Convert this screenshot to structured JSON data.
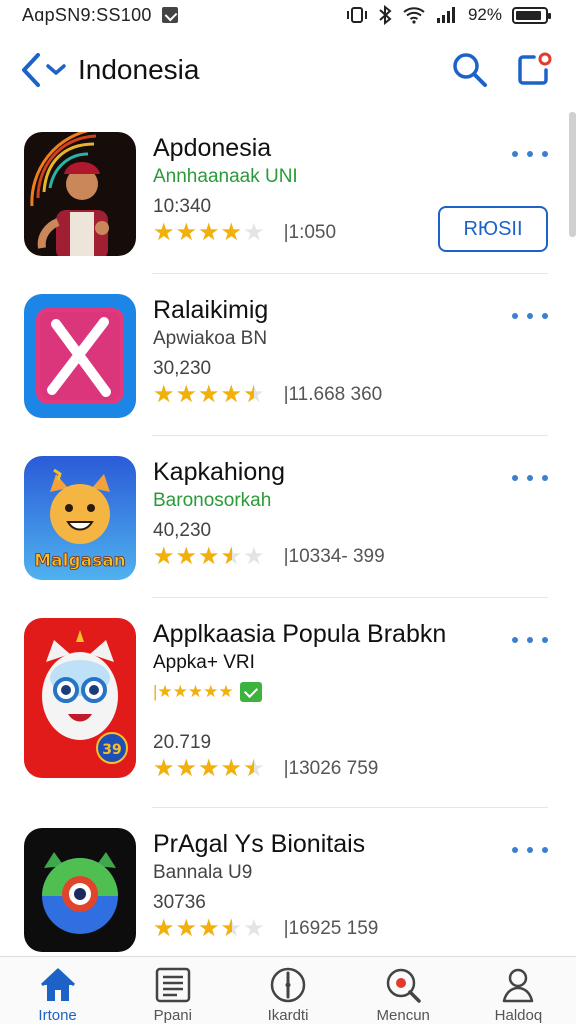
{
  "status_bar": {
    "time_text": "AɑpSN9:SS100",
    "battery": "92%",
    "battery_level": 0.92,
    "signal": "ıll"
  },
  "nav": {
    "title": "Indonesia"
  },
  "colors": {
    "accent": "#1d63c7",
    "star": "#f2b00a",
    "green_subtitle": "#2a9a3a"
  },
  "apps": [
    {
      "name": "Apdonesia",
      "subtitle": "Annhaanaak UNI",
      "subtitle_color": "#2a9a3a",
      "count": "10:340",
      "stars": 4,
      "rating_count": "|1:050",
      "button": "RЮSII"
    },
    {
      "name": "Ralaikimig",
      "subtitle": "Apwiakoa BN",
      "subtitle_color": "#444444",
      "count": "30,230",
      "stars": 4.5,
      "rating_count": "|11.668  360"
    },
    {
      "name": "Kapkahiong",
      "subtitle": "Baronosorkah",
      "subtitle_color": "#2a9a3a",
      "count": "40,230",
      "stars": 3.5,
      "rating_count": "|10334-  399",
      "icon_text": "Malgasan"
    },
    {
      "name": "Applkaasia Popula Brabkn",
      "subtitle": "Appka+ VRI",
      "subtitle_color": "#111111",
      "mini_rating": "|★★★★★",
      "count": "20.719",
      "stars": 4.5,
      "rating_count": "|13026  759",
      "icon_badge": "39"
    },
    {
      "name": "PrAgal Ys Bionitais",
      "subtitle": "Bannala U9",
      "subtitle_color": "#444444",
      "count": "30736",
      "stars": 3.5,
      "rating_count": "|16925  159"
    }
  ],
  "tabs": [
    {
      "label": "Irtone",
      "icon": "home-icon",
      "active": true
    },
    {
      "label": "Ppani",
      "icon": "newspaper-icon",
      "active": false
    },
    {
      "label": "Ikardti",
      "icon": "compass-icon",
      "active": false
    },
    {
      "label": "Mencun",
      "icon": "search-icon",
      "active": false
    },
    {
      "label": "Haldoq",
      "icon": "person-icon",
      "active": false
    }
  ]
}
